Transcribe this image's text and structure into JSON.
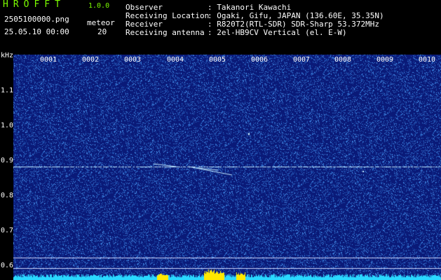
{
  "header": {
    "logo": "HROFFT",
    "version": "1.0.0",
    "filename": "2505100000.png",
    "datetime": "25.05.10 00:00",
    "meteor_label": "meteor",
    "meteor_count": "20",
    "info_labels": [
      "Observer",
      "Receiving Location",
      "Receiver",
      "Receiving antenna"
    ],
    "info_values": [
      ": Takanori Kawachi",
      ": Ogaki, Gifu, JAPAN (136.60E, 35.35N)",
      ": R820T2(RTL-SDR) SDR-Sharp 53.372MHz",
      ": 2el-HB9CV Vertical (el. E-W)"
    ]
  },
  "spectrogram": {
    "unit_label": "kHz",
    "y_ticks": [
      "1.1",
      "1.0",
      "0.9",
      "0.8",
      "0.7",
      "0.6"
    ],
    "x_ticks": [
      "0001",
      "0002",
      "0003",
      "0004",
      "0005",
      "0006",
      "0007",
      "0008",
      "0009",
      "0010"
    ],
    "carrier_khz": 0.88,
    "colors": {
      "background": "#0a1a78",
      "noise": "#3a7ad8",
      "signal": "#bfe8ff",
      "level_bar": "#2ad8ff",
      "level_peak": "#ffe800",
      "text": "#ffffff",
      "header_green": "#7CFC00"
    }
  }
}
